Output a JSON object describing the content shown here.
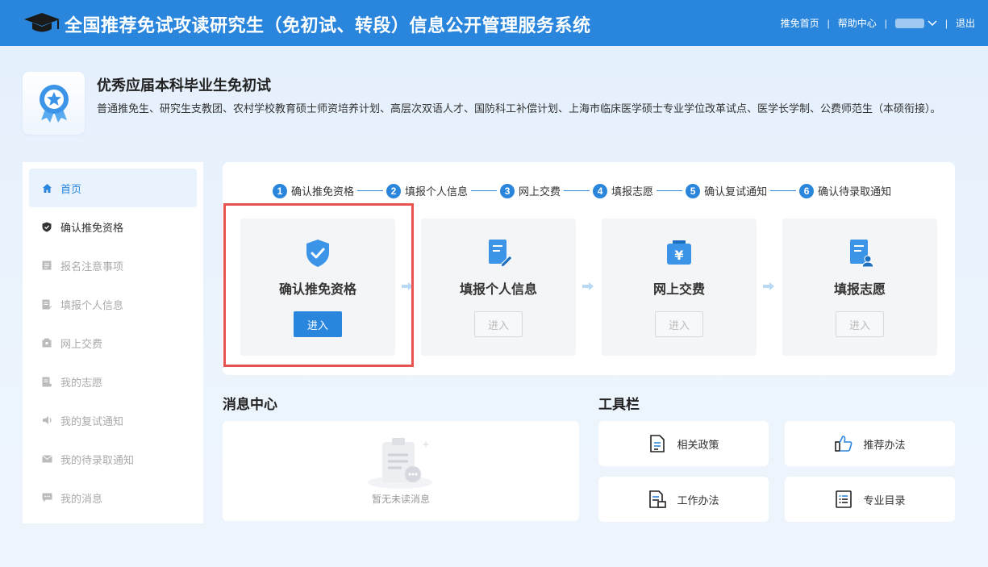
{
  "header": {
    "title": "全国推荐免试攻读研究生（免初试、转段）信息公开管理服务系统",
    "nav": {
      "home": "推免首页",
      "help": "帮助中心",
      "logout": "退出"
    },
    "separator": "|",
    "user_caret": "⌵"
  },
  "program": {
    "title": "优秀应届本科毕业生免初试",
    "description": "普通推免生、研究生支教团、农村学校教育硕士师资培养计划、高层次双语人才、国防科工补偿计划、上海市临床医学硕士专业学位改革试点、医学长学制、公费师范生（本硕衔接）。"
  },
  "sidebar": {
    "items": [
      {
        "label": "首页",
        "icon": "home-icon",
        "state": "active"
      },
      {
        "label": "确认推免资格",
        "icon": "shield-icon",
        "state": "done"
      },
      {
        "label": "报名注意事项",
        "icon": "notice-icon",
        "state": "disabled"
      },
      {
        "label": "填报个人信息",
        "icon": "edit-doc-icon",
        "state": "disabled"
      },
      {
        "label": "网上交费",
        "icon": "wallet-icon",
        "state": "disabled"
      },
      {
        "label": "我的志愿",
        "icon": "document-icon",
        "state": "disabled"
      },
      {
        "label": "我的复试通知",
        "icon": "speaker-icon",
        "state": "disabled"
      },
      {
        "label": "我的待录取通知",
        "icon": "mail-icon",
        "state": "disabled"
      },
      {
        "label": "我的消息",
        "icon": "message-icon",
        "state": "disabled"
      }
    ]
  },
  "steps": [
    {
      "num": "1",
      "label": "确认推免资格"
    },
    {
      "num": "2",
      "label": "填报个人信息"
    },
    {
      "num": "3",
      "label": "网上交费"
    },
    {
      "num": "4",
      "label": "填报志愿"
    },
    {
      "num": "5",
      "label": "确认复试通知"
    },
    {
      "num": "6",
      "label": "确认待录取通知"
    }
  ],
  "cards": [
    {
      "title": "确认推免资格",
      "button": "进入",
      "enabled": true,
      "icon": "shield-check-icon"
    },
    {
      "title": "填报个人信息",
      "button": "进入",
      "enabled": false,
      "icon": "edit-doc-icon"
    },
    {
      "title": "网上交费",
      "button": "进入",
      "enabled": false,
      "icon": "yuan-wallet-icon"
    },
    {
      "title": "填报志愿",
      "button": "进入",
      "enabled": false,
      "icon": "volunteer-doc-icon"
    }
  ],
  "messages": {
    "title": "消息中心",
    "empty_text": "暂无未读消息"
  },
  "tools": {
    "title": "工具栏",
    "items": [
      {
        "label": "相关政策",
        "icon": "policy-doc-icon"
      },
      {
        "label": "推荐办法",
        "icon": "thumbs-up-icon"
      },
      {
        "label": "工作办法",
        "icon": "work-doc-icon"
      },
      {
        "label": "专业目录",
        "icon": "list-icon"
      }
    ]
  },
  "colors": {
    "primary": "#2a86dd",
    "highlight": "#e8524f"
  }
}
